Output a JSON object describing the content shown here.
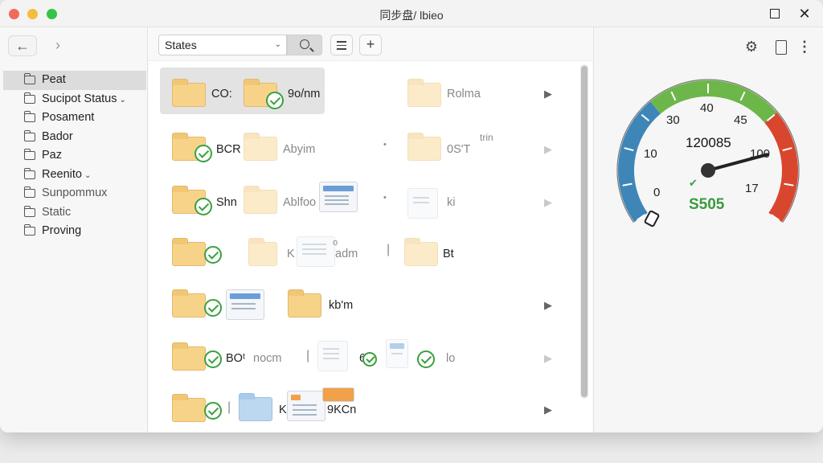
{
  "window": {
    "title": "同步盘/ lbieo"
  },
  "sidebar": {
    "items": [
      {
        "label": "Peat",
        "caret": ""
      },
      {
        "label": "Sucipot Status",
        "caret": "⌄"
      },
      {
        "label": "Posament",
        "caret": ""
      },
      {
        "label": "Bador",
        "caret": ""
      },
      {
        "label": "Paz",
        "caret": ""
      },
      {
        "label": "Reenito",
        "caret": "⌄"
      },
      {
        "label": "Sunpommux",
        "caret": ""
      },
      {
        "label": "Static",
        "caret": ""
      },
      {
        "label": "Proving",
        "caret": ""
      }
    ]
  },
  "toolbar": {
    "filter_value": "States"
  },
  "files": {
    "r1": {
      "a": "CO:",
      "b": "9o/nm",
      "c": "Rolma"
    },
    "r2": {
      "a": "BCR",
      "b": "Abyim",
      "c": "0S'T",
      "c_sub": "trin"
    },
    "r3": {
      "a": "Shn",
      "b": "Ablfoo",
      "c": "ki"
    },
    "r4": {
      "b": "K",
      "b2": "adm",
      "b_sup": "o",
      "c": "Bt"
    },
    "r5": {
      "b": "kb'm"
    },
    "r6": {
      "a": "BOᵗ",
      "a2": "nocm",
      "b": "6",
      "c": "lo"
    },
    "r7": {
      "b": "K",
      "b2": "9KCn"
    }
  },
  "gauge": {
    "ticks": [
      "0",
      "10",
      "30",
      "40",
      "45",
      "100",
      "17"
    ],
    "center_value": "120085",
    "readout": "S505",
    "needle_fraction": 0.8,
    "colors": {
      "low": "#3f86b8",
      "mid": "#6db64a",
      "high": "#d9462e",
      "readout": "#3b9a3f"
    }
  }
}
